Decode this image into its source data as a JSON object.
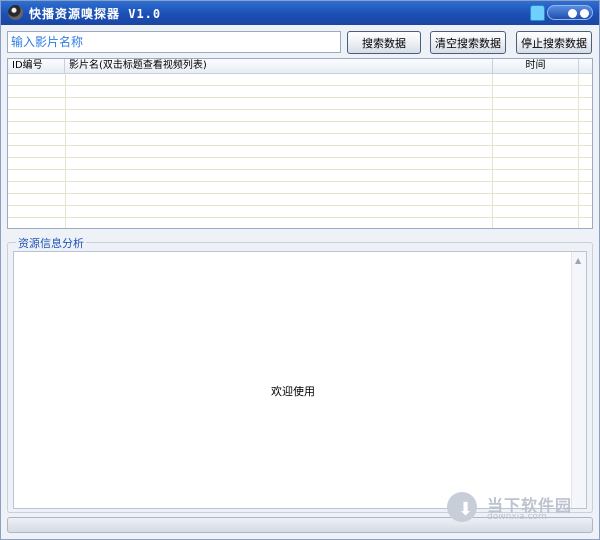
{
  "window": {
    "title": "快播资源嗅探器 V1.0"
  },
  "search": {
    "placeholder": "输入影片名称"
  },
  "buttons": {
    "search": "搜索数据",
    "clear": "清空搜索数据",
    "stop": "停止搜索数据"
  },
  "table": {
    "columns": [
      "ID编号",
      "影片名(双击标题查看视频列表)",
      "时间"
    ],
    "rows": []
  },
  "info": {
    "group_title": "资源信息分析",
    "content": "欢迎使用"
  },
  "watermark": {
    "title": "当下软件园",
    "url": "downxia.com"
  },
  "colors": {
    "titlebar": "#1c4fb5",
    "accent_text": "#1f53b4",
    "input_text": "#2f7de1"
  },
  "icons": [
    "app-icon",
    "skin-shirt-icon",
    "window-controls",
    "scroll-up-arrow-icon",
    "download-arrow-icon"
  ]
}
